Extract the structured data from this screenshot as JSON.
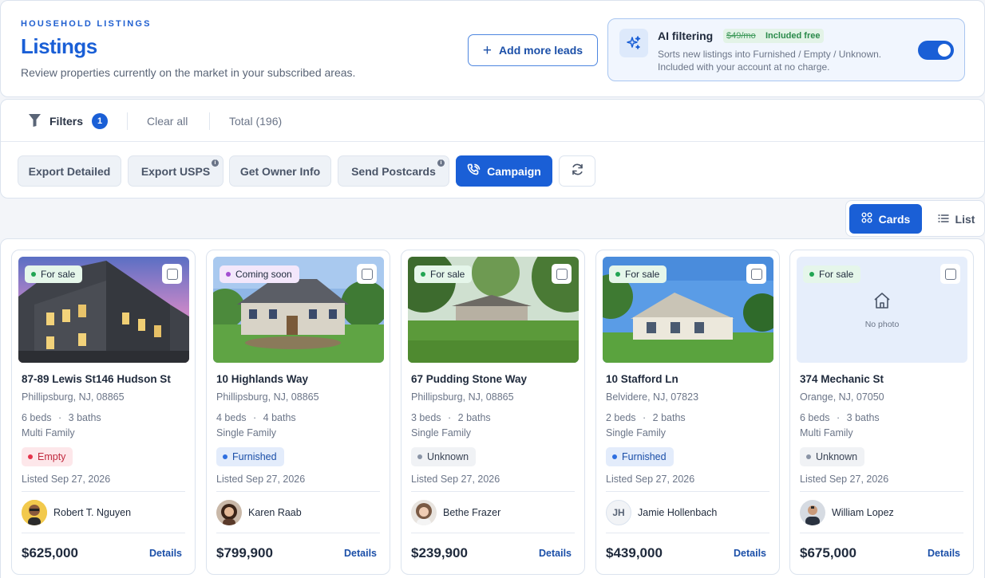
{
  "header": {
    "eyebrow": "HOUSEHOLD LISTINGS",
    "title": "Listings",
    "subtitle": "Review properties currently on the market in your subscribed areas.",
    "add_leads_label": "Add more leads",
    "ai": {
      "title": "AI filtering",
      "old_price": "$49/mo",
      "free_label": "Included free",
      "desc_line1": "Sorts new listings into Furnished / Empty / Unknown.",
      "desc_line2": "Included with your account at no charge.",
      "enabled": true
    }
  },
  "filters": {
    "label": "Filters",
    "count": "1",
    "clear_all": "Clear all",
    "total": "Total (196)"
  },
  "actions": {
    "export_detailed": "Export Detailed",
    "export_usps": "Export USPS",
    "get_owner_info": "Get Owner Info",
    "send_postcards": "Send Postcards",
    "campaign": "Campaign",
    "info_glyph": "i"
  },
  "view": {
    "cards": "Cards",
    "list": "List",
    "active": "cards"
  },
  "listings": [
    {
      "status": "For sale",
      "address": "87-89 Lewis St146 Hudson St",
      "city": "Phillipsburg, NJ, 08865",
      "beds": "6 beds",
      "baths": "3 baths",
      "type": "Multi Family",
      "furnishing": "Empty",
      "listed": "Listed Sep 27, 2026",
      "owner": "Robert T. Nguyen",
      "price": "$625,000",
      "details": "Details"
    },
    {
      "status": "Coming soon",
      "address": "10 Highlands Way",
      "city": "Phillipsburg, NJ, 08865",
      "beds": "4 beds",
      "baths": "4 baths",
      "type": "Single Family",
      "furnishing": "Furnished",
      "listed": "Listed Sep 27, 2026",
      "owner": "Karen Raab",
      "price": "$799,900",
      "details": "Details"
    },
    {
      "status": "For sale",
      "address": "67 Pudding Stone Way",
      "city": "Phillipsburg, NJ, 08865",
      "beds": "3 beds",
      "baths": "2 baths",
      "type": "Single Family",
      "furnishing": "Unknown",
      "listed": "Listed Sep 27, 2026",
      "owner": "Bethe Frazer",
      "price": "$239,900",
      "details": "Details"
    },
    {
      "status": "For sale",
      "address": "10 Stafford Ln",
      "city": "Belvidere, NJ, 07823",
      "beds": "2 beds",
      "baths": "2 baths",
      "type": "Single Family",
      "furnishing": "Furnished",
      "listed": "Listed Sep 27, 2026",
      "owner": "Jamie Hollenbach",
      "owner_initials": "JH",
      "price": "$439,000",
      "details": "Details"
    },
    {
      "status": "For sale",
      "address": "374 Mechanic St",
      "city": "Orange, NJ, 07050",
      "beds": "6 beds",
      "baths": "3 baths",
      "type": "Multi Family",
      "furnishing": "Unknown",
      "listed": "Listed Sep 27, 2026",
      "owner": "William Lopez",
      "price": "$675,000",
      "details": "Details",
      "no_photo": "No photo"
    }
  ],
  "colors": {
    "accent": "#1a5fd6",
    "for_sale_dot": "#22a553",
    "coming_soon_dot": "#a34fd1",
    "empty_bg": "#fde7ea",
    "empty_dot": "#e5344b",
    "furnished_bg": "#e3ecfb",
    "furnished_dot": "#2f6fe0",
    "unknown_bg": "#f0f2f5",
    "unknown_dot": "#8a94a6"
  }
}
